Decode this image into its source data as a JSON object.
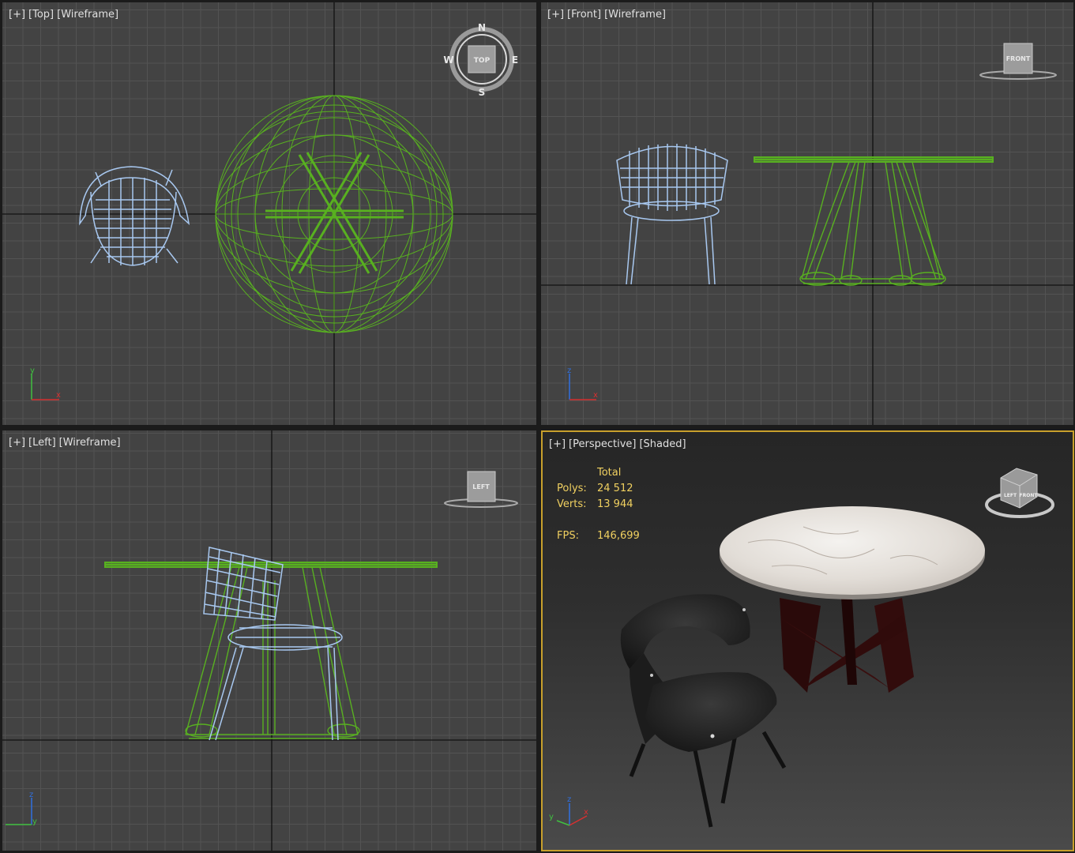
{
  "viewports": {
    "top": {
      "plus": "[+]",
      "view": "[Top]",
      "mode": "[Wireframe]",
      "compass": {
        "n": "N",
        "s": "S",
        "e": "E",
        "w": "W",
        "cube": "TOP"
      },
      "axes": {
        "a": "y",
        "b": "x"
      }
    },
    "front": {
      "plus": "[+]",
      "view": "[Front]",
      "mode": "[Wireframe]",
      "cube": "FRONT",
      "axes": {
        "a": "z",
        "b": "x"
      }
    },
    "left": {
      "plus": "[+]",
      "view": "[Left]",
      "mode": "[Wireframe]",
      "cube": "LEFT",
      "axes": {
        "a": "z",
        "b": "y"
      }
    },
    "perspective": {
      "plus": "[+]",
      "view": "[Perspective]",
      "mode": "[Shaded]",
      "cube_a": "LEFT",
      "cube_b": "FRONT",
      "axes": {
        "a": "z",
        "b": "x",
        "c": "y"
      },
      "stats": {
        "header": "Total",
        "polys_label": "Polys:",
        "polys_value": "24 512",
        "verts_label": "Verts:",
        "verts_value": "13 944",
        "fps_label": "FPS:",
        "fps_value": "146,699"
      }
    }
  },
  "colors": {
    "table_wire": "#58b020",
    "chair_wire": "#a8c8f0",
    "active_border": "#c8a02c",
    "stats_text": "#f0d060"
  }
}
